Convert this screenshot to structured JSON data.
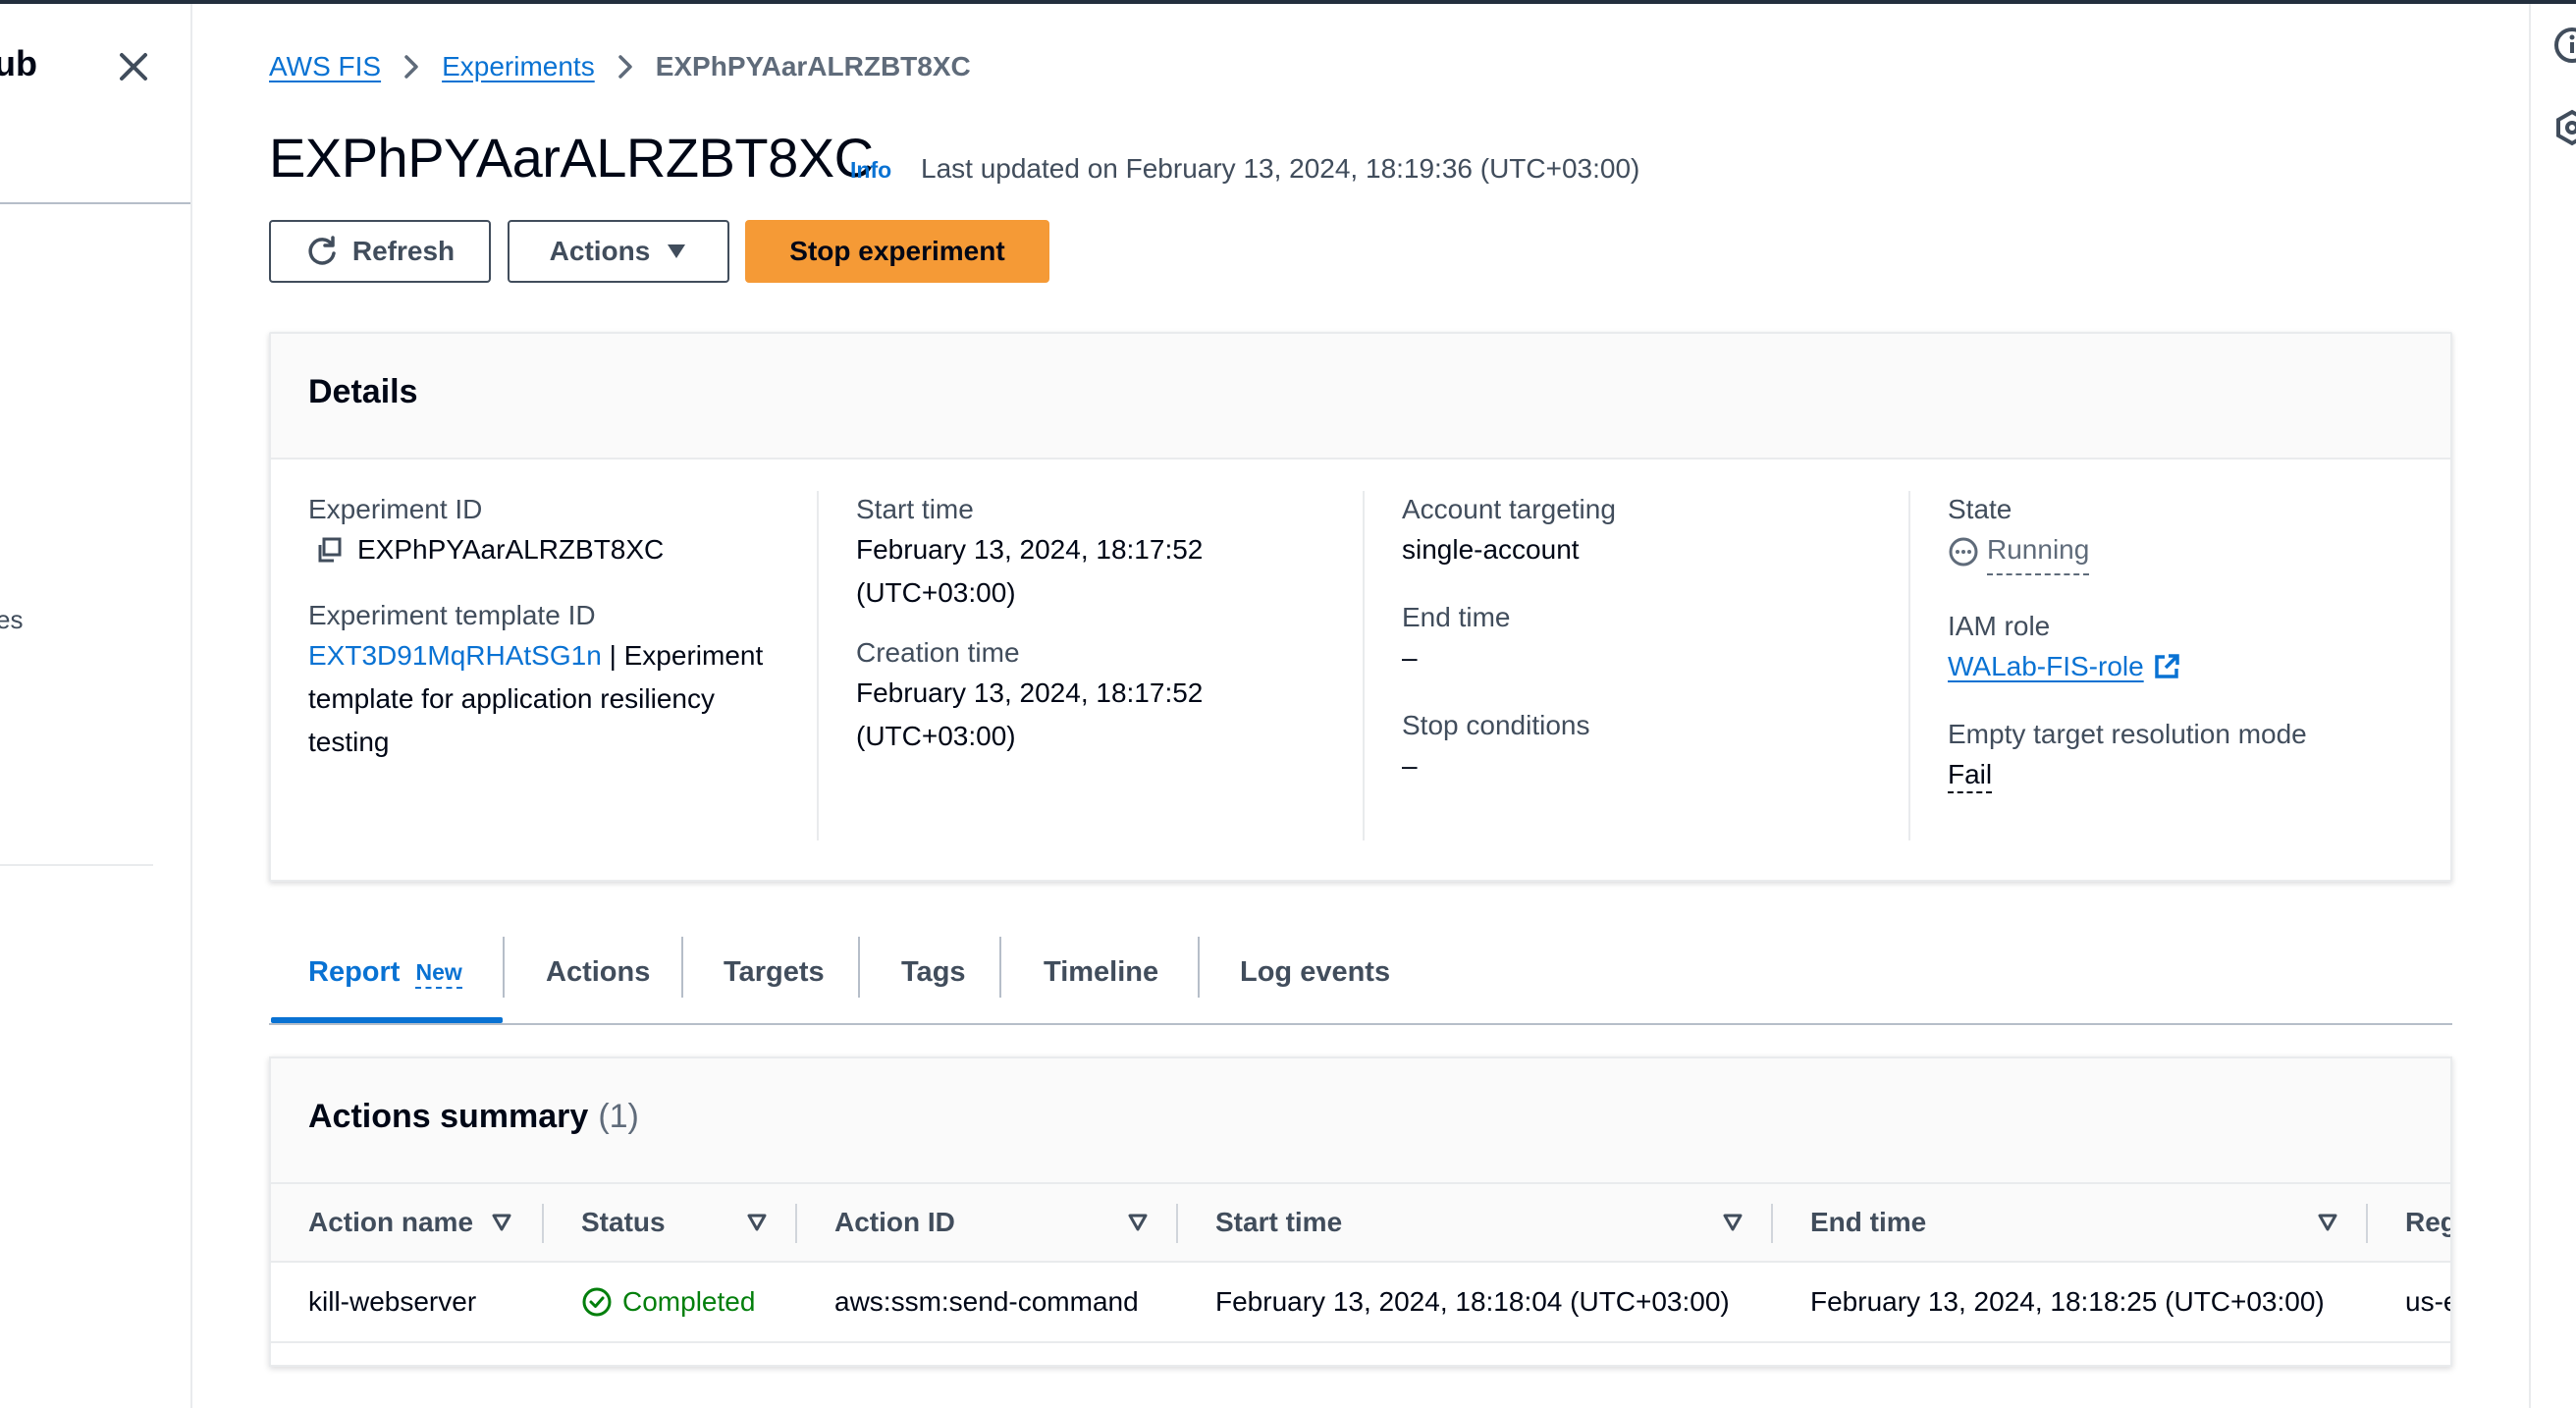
{
  "nav": {
    "title_fragment": "ub",
    "item_fragment": "es"
  },
  "breadcrumb": {
    "item1": "AWS FIS",
    "item2": "Experiments",
    "current": "EXPhPYAarALRZBT8XC"
  },
  "header": {
    "title": "EXPhPYAarALRZBT8XC",
    "info": "Info",
    "last_updated": "Last updated on February 13, 2024, 18:19:36 (UTC+03:00)"
  },
  "toolbar": {
    "refresh": "Refresh",
    "actions": "Actions",
    "stop": "Stop experiment"
  },
  "details": {
    "title": "Details",
    "experiment_id_label": "Experiment ID",
    "experiment_id": "EXPhPYAarALRZBT8XC",
    "template_id_label": "Experiment template ID",
    "template_id": "EXT3D91MqRHAtSG1n",
    "template_desc_line1": "| Experiment",
    "template_desc_line2": "template for application resiliency",
    "template_desc_line3": "testing",
    "start_time_label": "Start time",
    "start_time_line1": "February 13, 2024, 18:17:52",
    "start_time_line2": "(UTC+03:00)",
    "creation_time_label": "Creation time",
    "creation_time_line1": "February 13, 2024, 18:17:52",
    "creation_time_line2": "(UTC+03:00)",
    "account_targeting_label": "Account targeting",
    "account_targeting": "single-account",
    "end_time_label": "End time",
    "end_time": "–",
    "stop_conditions_label": "Stop conditions",
    "stop_conditions": "–",
    "state_label": "State",
    "state": "Running",
    "iam_role_label": "IAM role",
    "iam_role": "WALab-FIS-role",
    "empty_target_label": "Empty target resolution mode",
    "empty_target": "Fail"
  },
  "tabs": {
    "report": "Report",
    "report_badge": "New",
    "actions": "Actions",
    "targets": "Targets",
    "tags": "Tags",
    "timeline": "Timeline",
    "log_events": "Log events"
  },
  "actions_summary": {
    "title": "Actions summary",
    "count": "(1)",
    "columns": {
      "action_name": "Action name",
      "status": "Status",
      "action_id": "Action ID",
      "start_time": "Start time",
      "end_time": "End time",
      "region": "Reg"
    },
    "rows": [
      {
        "action_name": "kill-webserver",
        "status": "Completed",
        "action_id": "aws:ssm:send-command",
        "start_time": "February 13, 2024, 18:18:04 (UTC+03:00)",
        "end_time": "February 13, 2024, 18:18:25 (UTC+03:00)",
        "region": "us-e"
      }
    ]
  },
  "colors": {
    "link": "#0972d3",
    "primary_button": "#f59a36",
    "success": "#037f0c",
    "text": "#000716",
    "muted": "#414d5c"
  }
}
